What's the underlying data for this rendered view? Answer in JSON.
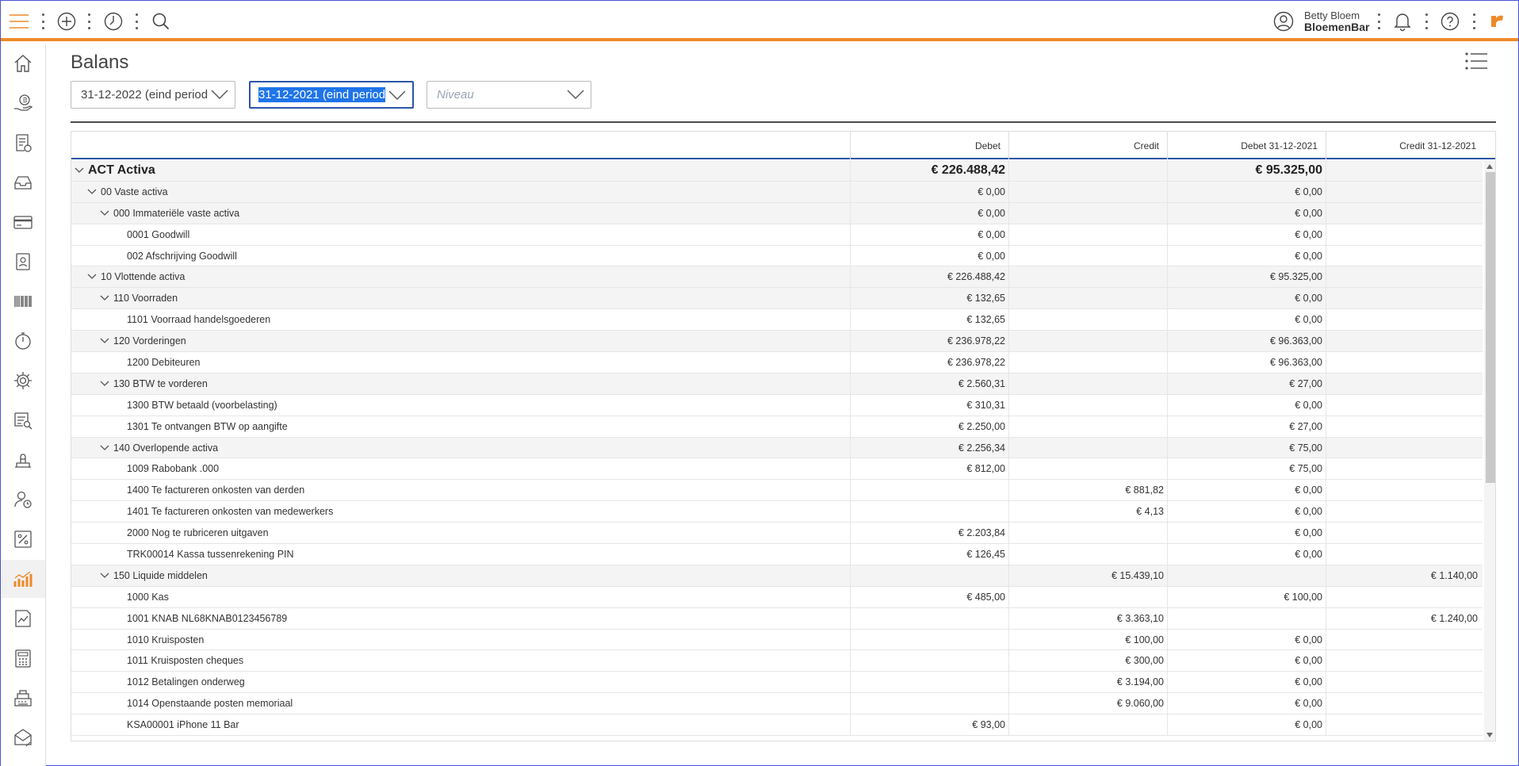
{
  "user": {
    "name": "Betty Bloem",
    "company": "BloemenBar"
  },
  "page": {
    "title": "Balans"
  },
  "filters": {
    "period_current": "31-12-2022 (eind period",
    "period_compare": "31-12-2021 (eind period",
    "level_placeholder": "Niveau"
  },
  "colors": {
    "accent": "#ee8a2a",
    "focus": "#2b55a8",
    "selection": "#1f74e8"
  },
  "sidebar_icons": [
    "home-icon",
    "hand-money-icon",
    "invoice-icon",
    "inbox-icon",
    "credit-card-icon",
    "contact-book-icon",
    "barcode-icon",
    "stopwatch-icon",
    "gear-icon",
    "report-search-icon",
    "stamp-icon",
    "user-clock-icon",
    "percent-icon",
    "bar-chart-icon",
    "chart-report-icon",
    "calculator-icon",
    "cash-register-icon",
    "mail-percent-icon"
  ],
  "table": {
    "columns": [
      "Debet",
      "Credit",
      "Debet 31-12-2021",
      "Credit 31-12-2021"
    ],
    "rows": [
      {
        "label": "ACT Activa",
        "level": 0,
        "group": true,
        "big": true,
        "debet": "€ 226.488,42",
        "credit": "",
        "debet_prev": "€ 95.325,00",
        "credit_prev": ""
      },
      {
        "label": "00 Vaste activa",
        "level": 1,
        "group": true,
        "debet": "€ 0,00",
        "credit": "",
        "debet_prev": "€ 0,00",
        "credit_prev": ""
      },
      {
        "label": "000 Immateriële vaste activa",
        "level": 2,
        "group": true,
        "debet": "€ 0,00",
        "credit": "",
        "debet_prev": "€ 0,00",
        "credit_prev": ""
      },
      {
        "label": "0001 Goodwill",
        "level": 3,
        "group": false,
        "debet": "€ 0,00",
        "credit": "",
        "debet_prev": "€ 0,00",
        "credit_prev": ""
      },
      {
        "label": "002 Afschrijving Goodwill",
        "level": 3,
        "group": false,
        "debet": "€ 0,00",
        "credit": "",
        "debet_prev": "€ 0,00",
        "credit_prev": ""
      },
      {
        "label": "10 Vlottende activa",
        "level": 1,
        "group": true,
        "debet": "€ 226.488,42",
        "credit": "",
        "debet_prev": "€ 95.325,00",
        "credit_prev": ""
      },
      {
        "label": "110 Voorraden",
        "level": 2,
        "group": true,
        "debet": "€ 132,65",
        "credit": "",
        "debet_prev": "€ 0,00",
        "credit_prev": ""
      },
      {
        "label": "1101 Voorraad handelsgoederen",
        "level": 3,
        "group": false,
        "debet": "€ 132,65",
        "credit": "",
        "debet_prev": "€ 0,00",
        "credit_prev": ""
      },
      {
        "label": "120 Vorderingen",
        "level": 2,
        "group": true,
        "debet": "€ 236.978,22",
        "credit": "",
        "debet_prev": "€ 96.363,00",
        "credit_prev": ""
      },
      {
        "label": "1200 Debiteuren",
        "level": 3,
        "group": false,
        "debet": "€ 236.978,22",
        "credit": "",
        "debet_prev": "€ 96.363,00",
        "credit_prev": ""
      },
      {
        "label": "130 BTW te vorderen",
        "level": 2,
        "group": true,
        "debet": "€ 2.560,31",
        "credit": "",
        "debet_prev": "€ 27,00",
        "credit_prev": ""
      },
      {
        "label": "1300 BTW betaald (voorbelasting)",
        "level": 3,
        "group": false,
        "debet": "€ 310,31",
        "credit": "",
        "debet_prev": "€ 0,00",
        "credit_prev": ""
      },
      {
        "label": "1301 Te ontvangen BTW op aangifte",
        "level": 3,
        "group": false,
        "debet": "€ 2.250,00",
        "credit": "",
        "debet_prev": "€ 27,00",
        "credit_prev": ""
      },
      {
        "label": "140 Overlopende activa",
        "level": 2,
        "group": true,
        "debet": "€ 2.256,34",
        "credit": "",
        "debet_prev": "€ 75,00",
        "credit_prev": ""
      },
      {
        "label": "1009 Rabobank .000",
        "level": 3,
        "group": false,
        "debet": "€ 812,00",
        "credit": "",
        "debet_prev": "€ 75,00",
        "credit_prev": ""
      },
      {
        "label": "1400 Te factureren onkosten van derden",
        "level": 3,
        "group": false,
        "debet": "",
        "credit": "€ 881,82",
        "debet_prev": "€ 0,00",
        "credit_prev": ""
      },
      {
        "label": "1401 Te factureren onkosten van medewerkers",
        "level": 3,
        "group": false,
        "debet": "",
        "credit": "€ 4,13",
        "debet_prev": "€ 0,00",
        "credit_prev": ""
      },
      {
        "label": "2000 Nog te rubriceren uitgaven",
        "level": 3,
        "group": false,
        "debet": "€ 2.203,84",
        "credit": "",
        "debet_prev": "€ 0,00",
        "credit_prev": ""
      },
      {
        "label": "TRK00014 Kassa tussenrekening PIN",
        "level": 3,
        "group": false,
        "debet": "€ 126,45",
        "credit": "",
        "debet_prev": "€ 0,00",
        "credit_prev": ""
      },
      {
        "label": "150 Liquide middelen",
        "level": 2,
        "group": true,
        "debet": "",
        "credit": "€ 15.439,10",
        "debet_prev": "",
        "credit_prev": "€ 1.140,00"
      },
      {
        "label": "1000 Kas",
        "level": 3,
        "group": false,
        "debet": "€ 485,00",
        "credit": "",
        "debet_prev": "€ 100,00",
        "credit_prev": ""
      },
      {
        "label": "1001 KNAB NL68KNAB0123456789",
        "level": 3,
        "group": false,
        "debet": "",
        "credit": "€ 3.363,10",
        "debet_prev": "",
        "credit_prev": "€ 1.240,00"
      },
      {
        "label": "1010 Kruisposten",
        "level": 3,
        "group": false,
        "debet": "",
        "credit": "€ 100,00",
        "debet_prev": "€ 0,00",
        "credit_prev": ""
      },
      {
        "label": "1011 Kruisposten cheques",
        "level": 3,
        "group": false,
        "debet": "",
        "credit": "€ 300,00",
        "debet_prev": "€ 0,00",
        "credit_prev": ""
      },
      {
        "label": "1012 Betalingen onderweg",
        "level": 3,
        "group": false,
        "debet": "",
        "credit": "€ 3.194,00",
        "debet_prev": "€ 0,00",
        "credit_prev": ""
      },
      {
        "label": "1014 Openstaande posten memoriaal",
        "level": 3,
        "group": false,
        "debet": "",
        "credit": "€ 9.060,00",
        "debet_prev": "€ 0,00",
        "credit_prev": ""
      },
      {
        "label": "KSA00001 iPhone 11 Bar",
        "level": 3,
        "group": false,
        "debet": "€ 93,00",
        "credit": "",
        "debet_prev": "€ 0,00",
        "credit_prev": ""
      }
    ]
  }
}
